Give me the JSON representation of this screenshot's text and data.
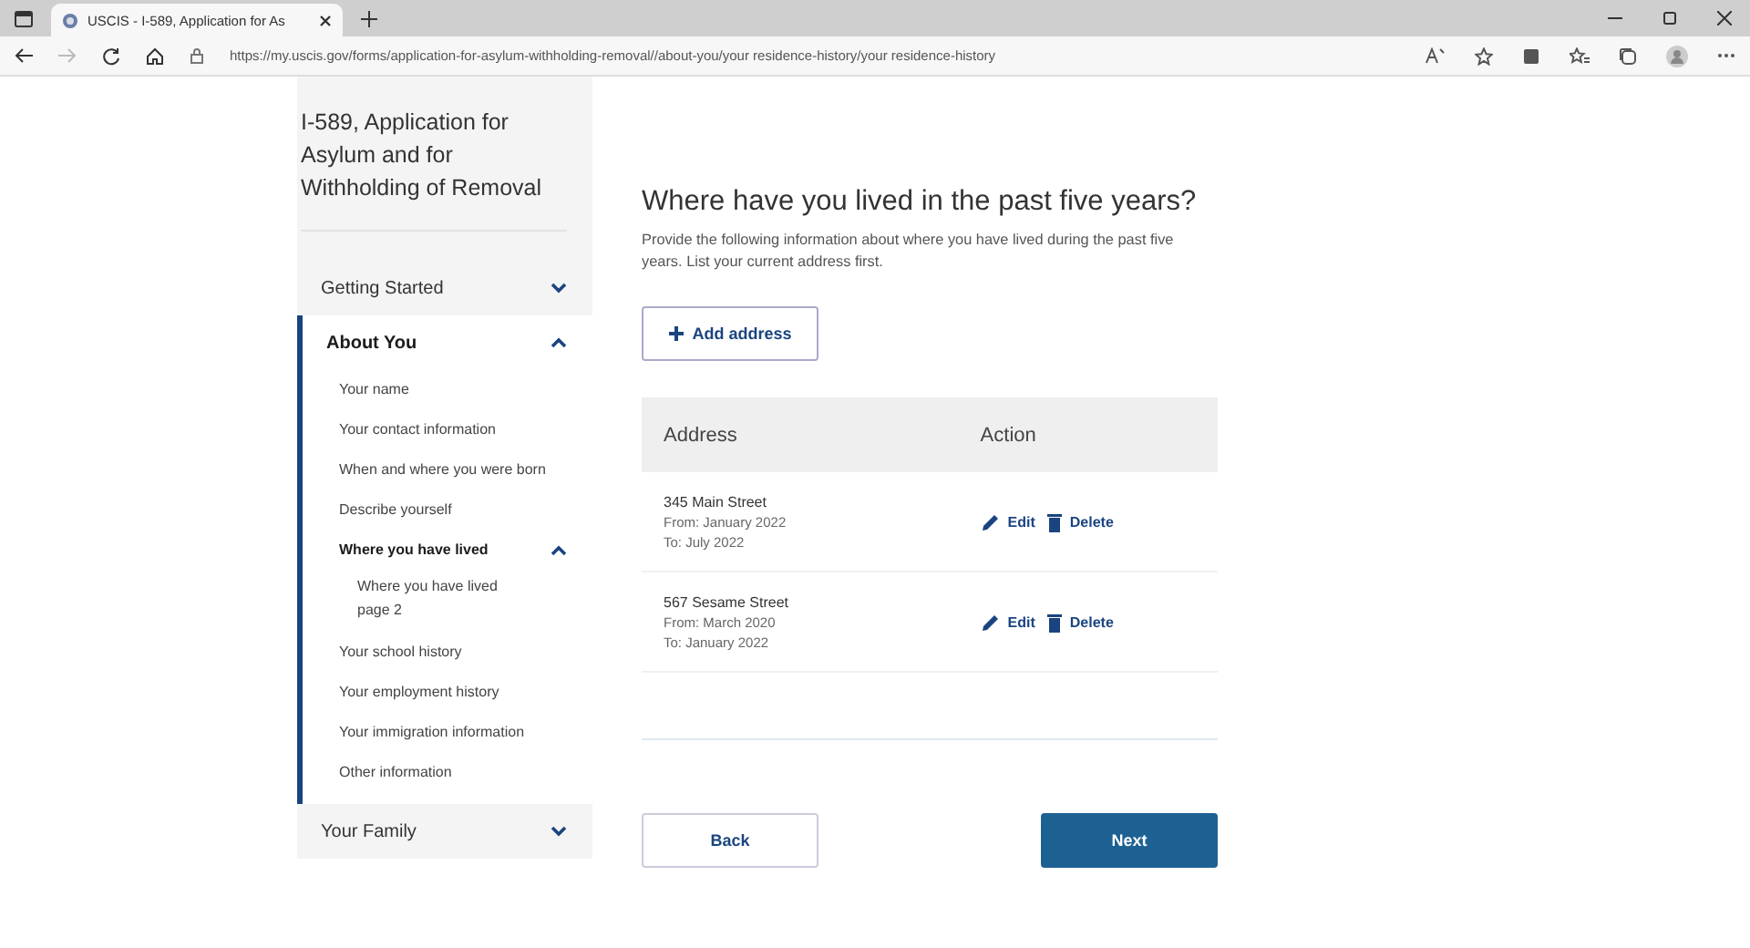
{
  "browser": {
    "tab_title": "USCIS - I-589, Application for As",
    "url": "https://my.uscis.gov/forms/application-for-asylum-withholding-removal//about-you/your residence-history/your residence-history"
  },
  "sidebar": {
    "title": "I-589, Application for Asylum and for Withholding of Removal",
    "sections": [
      {
        "label": "Getting Started",
        "expanded": false
      },
      {
        "label": "About You",
        "expanded": true,
        "children": [
          {
            "label": "Your name"
          },
          {
            "label": "Your contact information"
          },
          {
            "label": "When and where you were born"
          },
          {
            "label": "Describe yourself"
          },
          {
            "label": "Where you have lived",
            "expanded": true,
            "children": [
              {
                "label": "Where you have lived page 2"
              }
            ]
          },
          {
            "label": "Your school history"
          },
          {
            "label": "Your employment history"
          },
          {
            "label": "Your immigration information"
          },
          {
            "label": "Other information"
          }
        ]
      },
      {
        "label": "Your Family",
        "expanded": false
      }
    ]
  },
  "main": {
    "heading": "Where have you lived in the past five years?",
    "description": "Provide the following information about where you have lived during the past five years. List your current address first.",
    "add_button": "Add address",
    "table": {
      "columns": [
        "Address",
        "Action"
      ],
      "rows": [
        {
          "street": "345 Main Street",
          "from": "From: January 2022",
          "to": "To: July 2022",
          "edit": "Edit",
          "delete": "Delete"
        },
        {
          "street": "567 Sesame Street",
          "from": "From: March 2020",
          "to": "To: January 2022",
          "edit": "Edit",
          "delete": "Delete"
        }
      ]
    },
    "buttons": [
      "Back",
      "Next"
    ]
  }
}
